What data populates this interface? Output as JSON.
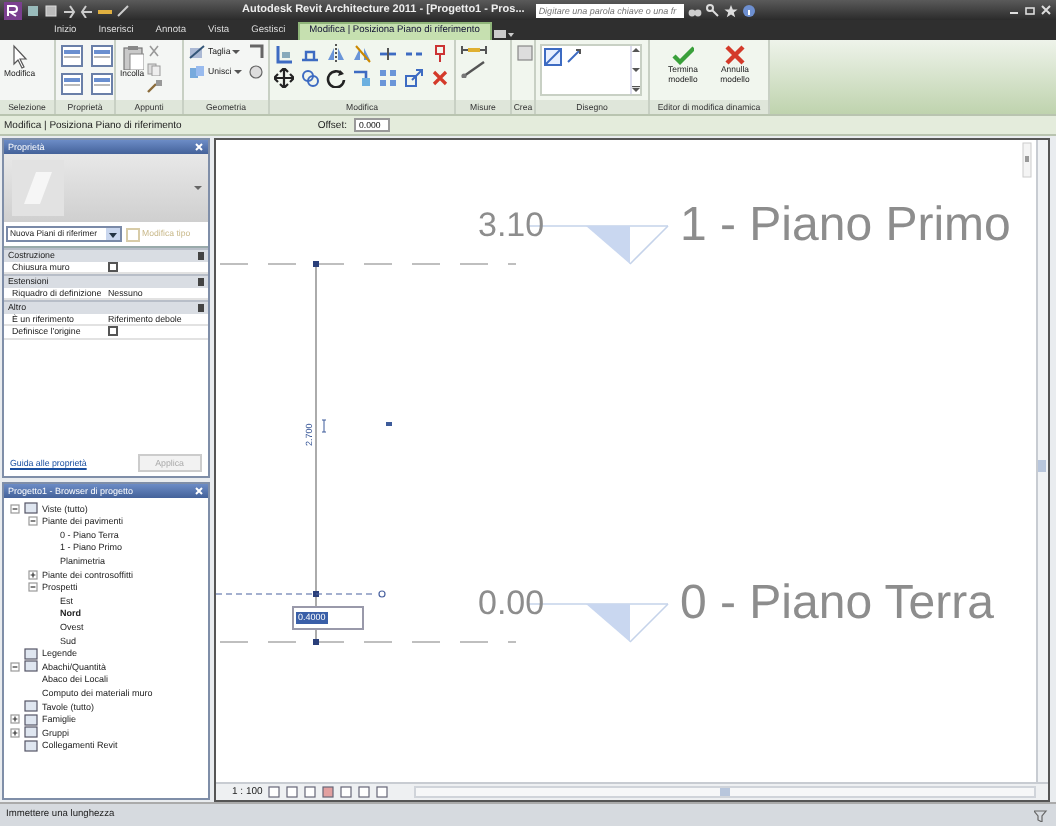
{
  "window": {
    "title": "Autodesk Revit Architecture 2011 - [Progetto1 - Pros...",
    "search": {
      "placeholder": "Digitare una parola chiave o una fr"
    }
  },
  "tabs": [
    {
      "label": "Inizio",
      "selected": false
    },
    {
      "label": "Inserisci",
      "selected": false
    },
    {
      "label": "Annota",
      "selected": false
    },
    {
      "label": "Vista",
      "selected": false
    },
    {
      "label": "Gestisci",
      "selected": false
    },
    {
      "label": "Modifica | Posiziona Piano di riferimento",
      "selected": true
    }
  ],
  "ribbon_panels": [
    {
      "label": "Selezione",
      "buttons": [
        "Modifica"
      ]
    },
    {
      "label": "Proprietà"
    },
    {
      "label": "Appunti",
      "buttons": [
        "Incolla"
      ]
    },
    {
      "label": "Geometria",
      "buttons": [
        "Taglia",
        "Unisci"
      ]
    },
    {
      "label": "Modifica"
    },
    {
      "label": "Misure"
    },
    {
      "label": "Crea"
    },
    {
      "label": "Disegno"
    },
    {
      "label": "Editor di modifica dinamica",
      "buttons": [
        "Termina modello",
        "Annulla modello"
      ]
    }
  ],
  "options_bar": {
    "context": "Modifica | Posiziona Piano di riferimento",
    "offset_label": "Offset:",
    "offset_value": "0.000"
  },
  "properties": {
    "title": "Proprietà",
    "type_selector": "Nuova Piani di riferimer",
    "edit_type": {
      "label": "Modifica tipo",
      "disabled": true
    },
    "groups": [
      {
        "name": "Costruzione",
        "rows": [
          {
            "label": "Chiusura muro",
            "kind": "checkbox",
            "checked": false
          }
        ]
      },
      {
        "name": "Estensioni",
        "rows": [
          {
            "label": "Riquadro di definizione",
            "kind": "text",
            "value": "Nessuno"
          }
        ]
      },
      {
        "name": "Altro",
        "rows": [
          {
            "label": "È un riferimento",
            "kind": "text",
            "value": "Riferimento debole"
          },
          {
            "label": "Definisce l'origine",
            "kind": "checkbox",
            "checked": false
          }
        ]
      }
    ],
    "help_link": "Guida alle proprietà",
    "apply": {
      "label": "Applica",
      "disabled": true
    }
  },
  "project_browser": {
    "title": "Progetto1 - Browser di progetto",
    "tree": [
      {
        "label": "Viste (tutto)",
        "selected": false,
        "expanded": true,
        "children": [
          {
            "label": "Piante dei pavimenti",
            "selected": false,
            "expanded": true,
            "children": [
              {
                "label": "0 - Piano Terra",
                "selected": false
              },
              {
                "label": "1 - Piano Primo",
                "selected": false
              },
              {
                "label": "Planimetria",
                "selected": false
              }
            ]
          },
          {
            "label": "Piante dei controsoffitti",
            "selected": false,
            "expanded": false
          },
          {
            "label": "Prospetti",
            "selected": false,
            "expanded": true,
            "children": [
              {
                "label": "Est",
                "selected": false
              },
              {
                "label": "Nord",
                "selected": true
              },
              {
                "label": "Ovest",
                "selected": false
              },
              {
                "label": "Sud",
                "selected": false
              }
            ]
          }
        ]
      },
      {
        "label": "Legende",
        "selected": false
      },
      {
        "label": "Abachi/Quantità",
        "selected": false,
        "expanded": true,
        "children": [
          {
            "label": "Abaco dei Locali",
            "selected": false
          },
          {
            "label": "Computo dei materiali muro",
            "selected": false
          }
        ]
      },
      {
        "label": "Tavole (tutto)",
        "selected": false
      },
      {
        "label": "Famiglie",
        "selected": false,
        "expanded": false
      },
      {
        "label": "Gruppi",
        "selected": false,
        "expanded": false
      },
      {
        "label": "Collegamenti Revit",
        "selected": false
      }
    ]
  },
  "canvas": {
    "levels": [
      {
        "elevation": "3.10",
        "name": "1 - Piano Primo"
      },
      {
        "elevation": "0.00",
        "name": "0 - Piano Terra"
      }
    ],
    "dimension": "2.700",
    "length_input": "0.4000"
  },
  "view_bar": {
    "scale": "1 : 100"
  },
  "status_bar": {
    "message": "Immettere una lunghezza"
  }
}
